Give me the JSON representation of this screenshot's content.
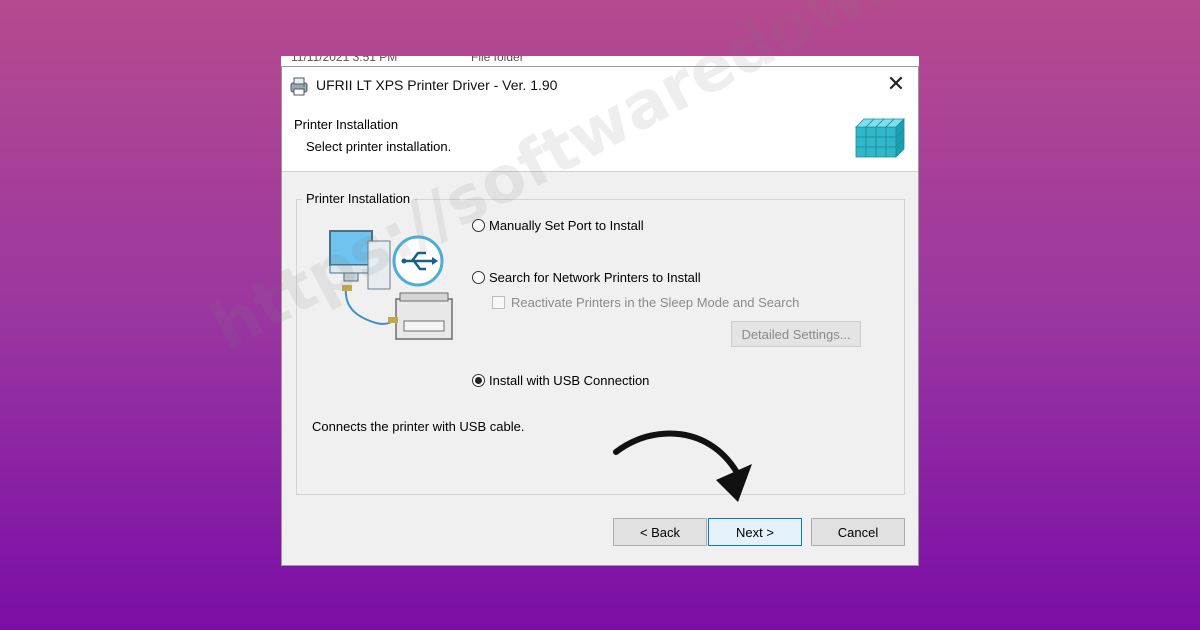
{
  "background_window": {
    "date_fragment": "11/11/2021 3:51 PM",
    "type_fragment": "File folder"
  },
  "window": {
    "title": "UFRII LT XPS Printer Driver - Ver. 1.90",
    "close_glyph": "✕"
  },
  "header": {
    "title": "Printer Installation",
    "subtitle": "Select printer installation."
  },
  "group": {
    "label": "Printer Installation",
    "options": [
      {
        "label": "Manually Set Port to Install",
        "checked": false
      },
      {
        "label": "Search for Network Printers to Install",
        "checked": false
      },
      {
        "label": "Install with USB Connection",
        "checked": true
      }
    ],
    "reactivate_label": "Reactivate Printers in the Sleep Mode and Search",
    "detailed_settings_label": "Detailed Settings...",
    "description": "Connects the printer with USB cable."
  },
  "buttons": {
    "back": "< Back",
    "next": "Next >",
    "cancel": "Cancel"
  },
  "watermark": "https://softwaredownload.com",
  "colors": {
    "bg_top": "#b64a8e",
    "bg_bottom": "#7a0ea6",
    "focus_blue": "#0078d7"
  }
}
